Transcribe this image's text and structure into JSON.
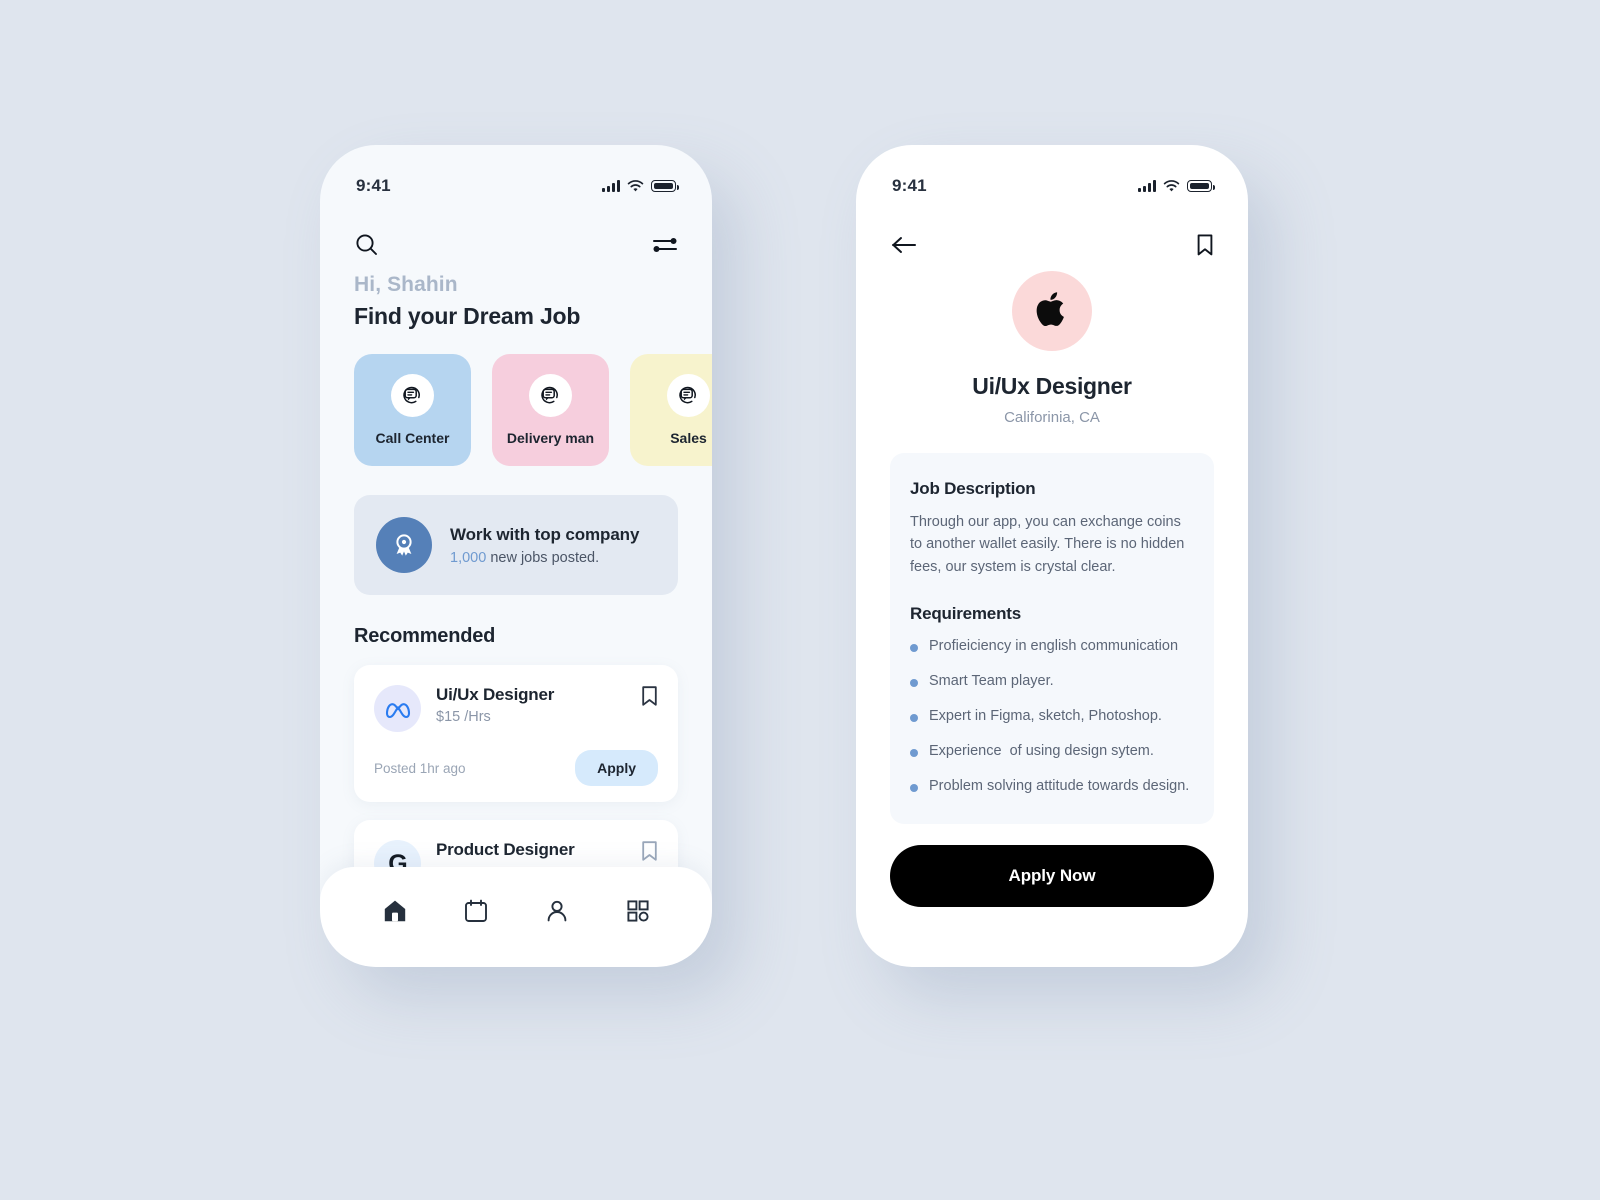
{
  "status_bar": {
    "time": "9:41"
  },
  "home": {
    "search_icon": "search-icon",
    "filter_icon": "filter-sliders-icon",
    "greeting": "Hi, Shahin",
    "headline": "Find your Dream Job",
    "categories": [
      {
        "label": "Call Center",
        "color": "#b6d5f0",
        "icon": "headset-chat-icon"
      },
      {
        "label": "Delivery man",
        "color": "#f6cedd",
        "icon": "headset-chat-icon"
      },
      {
        "label": "Sales",
        "color": "#f7f3cd",
        "icon": "headset-chat-icon"
      }
    ],
    "promo": {
      "icon": "award-ribbon-icon",
      "title": "Work with top company",
      "count": "1,000",
      "subtitle_rest": " new jobs posted."
    },
    "section_title": "Recommended",
    "jobs": [
      {
        "company_icon": "meta-infinity-icon",
        "logo_bg": "#e6e8fb",
        "title": "Ui/Ux Designer",
        "pay": "$15 /Hrs",
        "posted": "Posted 1hr ago",
        "apply_label": "Apply",
        "bookmark_icon": "bookmark-icon"
      },
      {
        "company_icon": "google-g-icon",
        "logo_bg": "#e8f2fd",
        "title": "Product Designer",
        "pay": "",
        "posted": "",
        "apply_label": "",
        "bookmark_icon": "bookmark-icon"
      }
    ],
    "nav": [
      {
        "name": "home-icon",
        "active": true
      },
      {
        "name": "calendar-icon",
        "active": false
      },
      {
        "name": "profile-icon",
        "active": false
      },
      {
        "name": "grid-icon",
        "active": false
      }
    ]
  },
  "detail": {
    "back_icon": "back-arrow-icon",
    "bookmark_icon": "bookmark-icon",
    "company_logo_icon": "apple-logo-icon",
    "logo_bg": "#fbd9d9",
    "title": "Ui/Ux Designer",
    "location": "Califorinia, CA",
    "description_heading": "Job Description",
    "description": "Through our app, you can exchange coins to another wallet easily. There is no hidden fees, our system is crystal clear.",
    "requirements_heading": "Requirements",
    "requirements": [
      "Profieiciency in english communication",
      "Smart Team player.",
      "Expert in Figma, sketch, Photoshop.",
      "Experience  of using design sytem.",
      "Problem solving attitude towards design."
    ],
    "cta_label": "Apply Now"
  },
  "colors": {
    "page_bg": "#dfe5ee",
    "accent_blue": "#6f9ad0",
    "promo_circle": "#5580b8",
    "apply_pill": "#d6eafc",
    "cta_bg": "#000000"
  }
}
